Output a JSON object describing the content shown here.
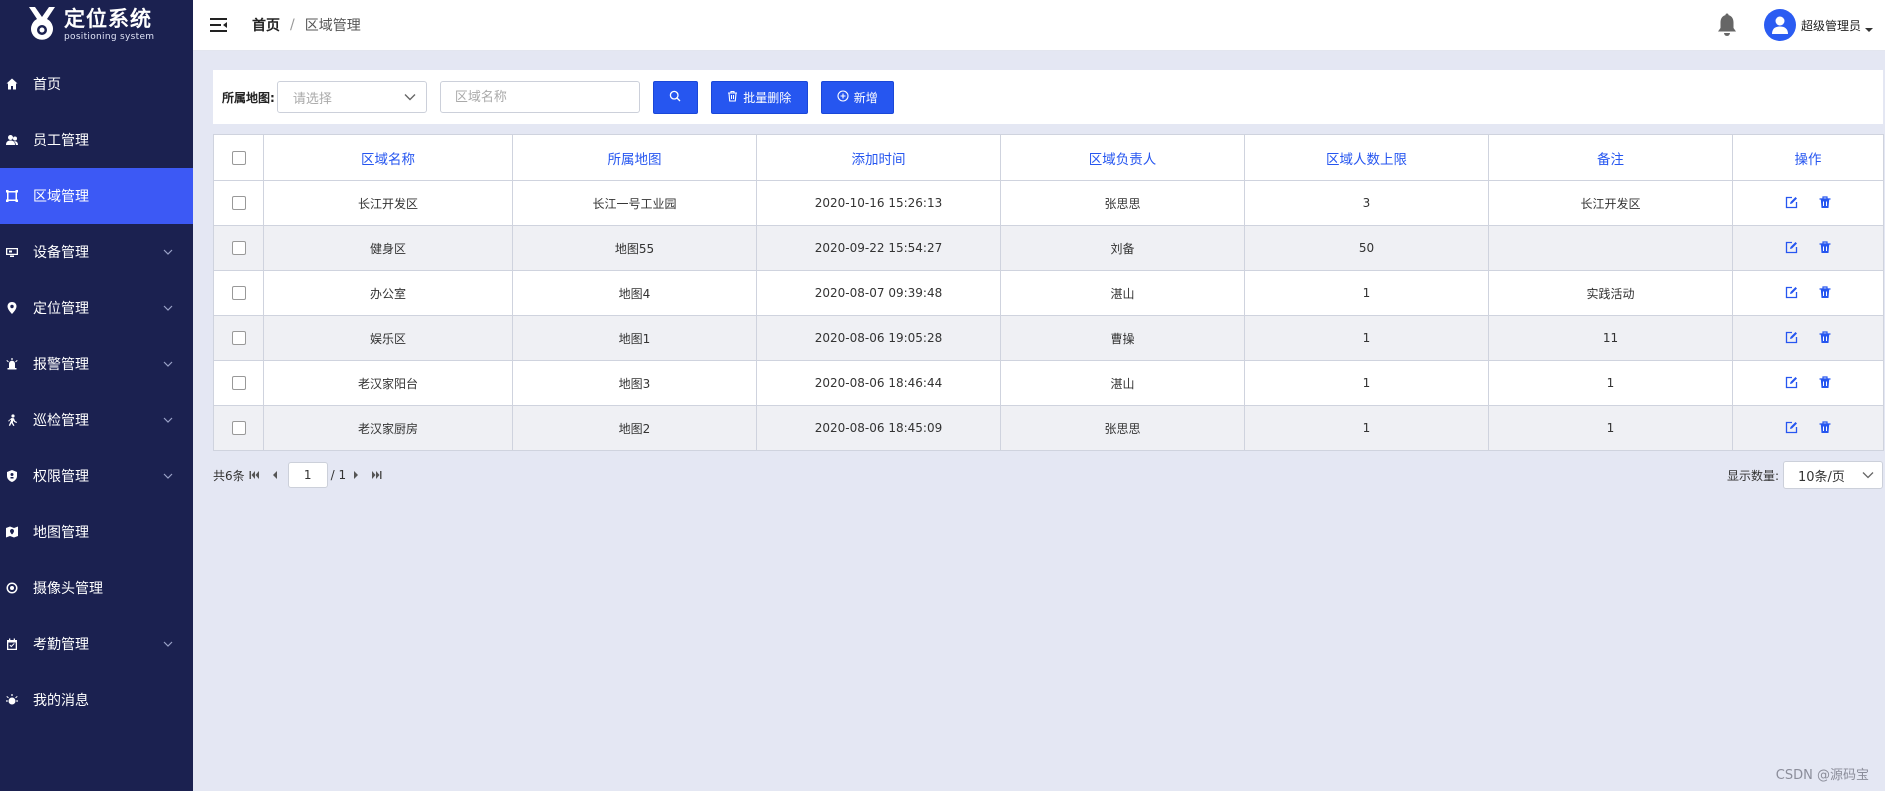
{
  "app": {
    "logo_title": "定位系统",
    "logo_subtitle": "positioning system"
  },
  "sidebar": {
    "items": [
      {
        "label": "首页",
        "icon": "home-icon",
        "expandable": false,
        "active": false
      },
      {
        "label": "员工管理",
        "icon": "users-icon",
        "expandable": false,
        "active": false
      },
      {
        "label": "区域管理",
        "icon": "area-icon",
        "expandable": false,
        "active": true
      },
      {
        "label": "设备管理",
        "icon": "device-icon",
        "expandable": true,
        "active": false
      },
      {
        "label": "定位管理",
        "icon": "location-pin-icon",
        "expandable": true,
        "active": false
      },
      {
        "label": "报警管理",
        "icon": "alarm-icon",
        "expandable": true,
        "active": false
      },
      {
        "label": "巡检管理",
        "icon": "patrol-icon",
        "expandable": true,
        "active": false
      },
      {
        "label": "权限管理",
        "icon": "shield-icon",
        "expandable": true,
        "active": false
      },
      {
        "label": "地图管理",
        "icon": "map-icon",
        "expandable": false,
        "active": false
      },
      {
        "label": "摄像头管理",
        "icon": "camera-icon",
        "expandable": false,
        "active": false
      },
      {
        "label": "考勤管理",
        "icon": "attendance-icon",
        "expandable": true,
        "active": false
      },
      {
        "label": "我的消息",
        "icon": "message-icon",
        "expandable": false,
        "active": false
      }
    ]
  },
  "header": {
    "breadcrumb_home": "首页",
    "breadcrumb_sep": "/",
    "breadcrumb_current": "区域管理",
    "user_name": "超级管理员"
  },
  "filter": {
    "map_label": "所属地图:",
    "map_placeholder": "请选择",
    "name_placeholder": "区域名称",
    "name_value": "",
    "batch_delete_label": "批量删除",
    "add_label": "新增"
  },
  "table": {
    "columns": [
      "区域名称",
      "所属地图",
      "添加时间",
      "区域负责人",
      "区域人数上限",
      "备注",
      "操作"
    ],
    "rows": [
      {
        "name": "长江开发区",
        "map": "长江一号工业园",
        "time": "2020-10-16 15:26:13",
        "owner": "张思思",
        "limit": "3",
        "note": "长江开发区"
      },
      {
        "name": "健身区",
        "map": "地图55",
        "time": "2020-09-22 15:54:27",
        "owner": "刘备",
        "limit": "50",
        "note": ""
      },
      {
        "name": "办公室",
        "map": "地图4",
        "time": "2020-08-07 09:39:48",
        "owner": "湛山",
        "limit": "1",
        "note": "实践活动"
      },
      {
        "name": "娱乐区",
        "map": "地图1",
        "time": "2020-08-06 19:05:28",
        "owner": "曹操",
        "limit": "1",
        "note": "11"
      },
      {
        "name": "老汉家阳台",
        "map": "地图3",
        "time": "2020-08-06 18:46:44",
        "owner": "湛山",
        "limit": "1",
        "note": "1"
      },
      {
        "name": "老汉家厨房",
        "map": "地图2",
        "time": "2020-08-06 18:45:09",
        "owner": "张思思",
        "limit": "1",
        "note": "1"
      }
    ]
  },
  "pagination": {
    "total_text": "共6条",
    "current_page": "1",
    "total_pages_text": "/ 1",
    "page_size_label": "显示数量:",
    "page_size_value": "10条/页"
  },
  "watermark": "CSDN @源码宝",
  "colors": {
    "sidebar_bg": "#1b2150",
    "accent": "#2656f0",
    "active_menu": "#3c59f5",
    "page_bg": "#e4e7f3"
  }
}
